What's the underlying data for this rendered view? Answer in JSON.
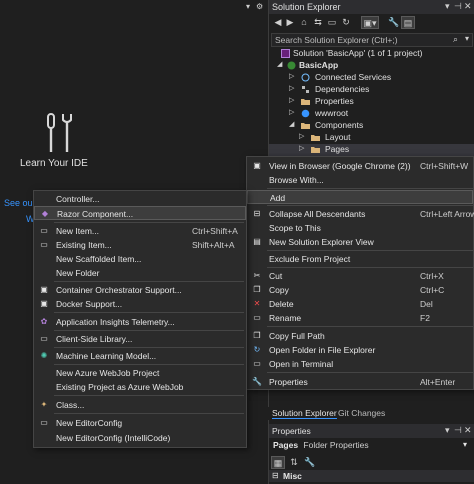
{
  "editor": {
    "learn_label": "Learn Your IDE",
    "see_our": "See our",
    "w_text": "W"
  },
  "solution_explorer": {
    "title": "Solution Explorer",
    "search_placeholder": "Search Solution Explorer (Ctrl+;)",
    "tree": [
      {
        "label": "Solution 'BasicApp' (1 of 1 project)",
        "icon": "solution-icon"
      },
      {
        "label": "BasicApp",
        "icon": "csharp-project-icon"
      },
      {
        "label": "Connected Services",
        "icon": "connected-services-icon"
      },
      {
        "label": "Dependencies",
        "icon": "dependencies-icon"
      },
      {
        "label": "Properties",
        "icon": "properties-folder-icon"
      },
      {
        "label": "wwwroot",
        "icon": "globe-icon"
      },
      {
        "label": "Components",
        "icon": "folder-icon"
      },
      {
        "label": "Layout",
        "icon": "folder-icon"
      },
      {
        "label": "Pages",
        "icon": "folder-icon"
      }
    ]
  },
  "context_menu": {
    "items": [
      {
        "label": "View in Browser (Google Chrome (2))",
        "shortcut": "Ctrl+Shift+W",
        "icon": "browser-icon"
      },
      {
        "label": "Browse With...",
        "shortcut": "",
        "icon": ""
      },
      {
        "label": "Add",
        "shortcut": "",
        "icon": ""
      },
      {
        "label": "Collapse All Descendants",
        "shortcut": "Ctrl+Left Arrow",
        "icon": "collapse-icon"
      },
      {
        "label": "Scope to This",
        "shortcut": "",
        "icon": ""
      },
      {
        "label": "New Solution Explorer View",
        "shortcut": "",
        "icon": "new-view-icon"
      },
      {
        "label": "Exclude From Project",
        "shortcut": "",
        "icon": ""
      },
      {
        "label": "Cut",
        "shortcut": "Ctrl+X",
        "icon": "scissors-icon"
      },
      {
        "label": "Copy",
        "shortcut": "Ctrl+C",
        "icon": "copy-icon"
      },
      {
        "label": "Delete",
        "shortcut": "Del",
        "icon": "delete-icon"
      },
      {
        "label": "Rename",
        "shortcut": "F2",
        "icon": "rename-icon"
      },
      {
        "label": "Copy Full Path",
        "shortcut": "",
        "icon": "copy-path-icon"
      },
      {
        "label": "Open Folder in File Explorer",
        "shortcut": "",
        "icon": "open-folder-icon"
      },
      {
        "label": "Open in Terminal",
        "shortcut": "",
        "icon": "terminal-icon"
      },
      {
        "label": "Properties",
        "shortcut": "Alt+Enter",
        "icon": "wrench-icon"
      }
    ]
  },
  "add_submenu": {
    "items": [
      {
        "label": "Controller...",
        "shortcut": ""
      },
      {
        "label": "Razor Component...",
        "shortcut": ""
      },
      {
        "label": "New Item...",
        "shortcut": "Ctrl+Shift+A"
      },
      {
        "label": "Existing Item...",
        "shortcut": "Shift+Alt+A"
      },
      {
        "label": "New Scaffolded Item...",
        "shortcut": ""
      },
      {
        "label": "New Folder",
        "shortcut": ""
      },
      {
        "label": "Container Orchestrator Support...",
        "shortcut": ""
      },
      {
        "label": "Docker Support...",
        "shortcut": ""
      },
      {
        "label": "Application Insights Telemetry...",
        "shortcut": ""
      },
      {
        "label": "Client-Side Library...",
        "shortcut": ""
      },
      {
        "label": "Machine Learning Model...",
        "shortcut": ""
      },
      {
        "label": "New Azure WebJob Project",
        "shortcut": ""
      },
      {
        "label": "Existing Project as Azure WebJob",
        "shortcut": ""
      },
      {
        "label": "Class...",
        "shortcut": ""
      },
      {
        "label": "New EditorConfig",
        "shortcut": ""
      },
      {
        "label": "New EditorConfig (IntelliCode)",
        "shortcut": ""
      }
    ]
  },
  "bottom_tabs": {
    "solution_explorer": "Solution Explorer",
    "git_changes": "Git Changes"
  },
  "properties_panel": {
    "title": "Properties",
    "object_name": "Pages",
    "object_type": "Folder Properties",
    "misc": "Misc"
  },
  "colors": {
    "accent_blue": "#3794ff",
    "highlight": "#3d3d3d",
    "menu_bg": "#2b2b2b"
  }
}
